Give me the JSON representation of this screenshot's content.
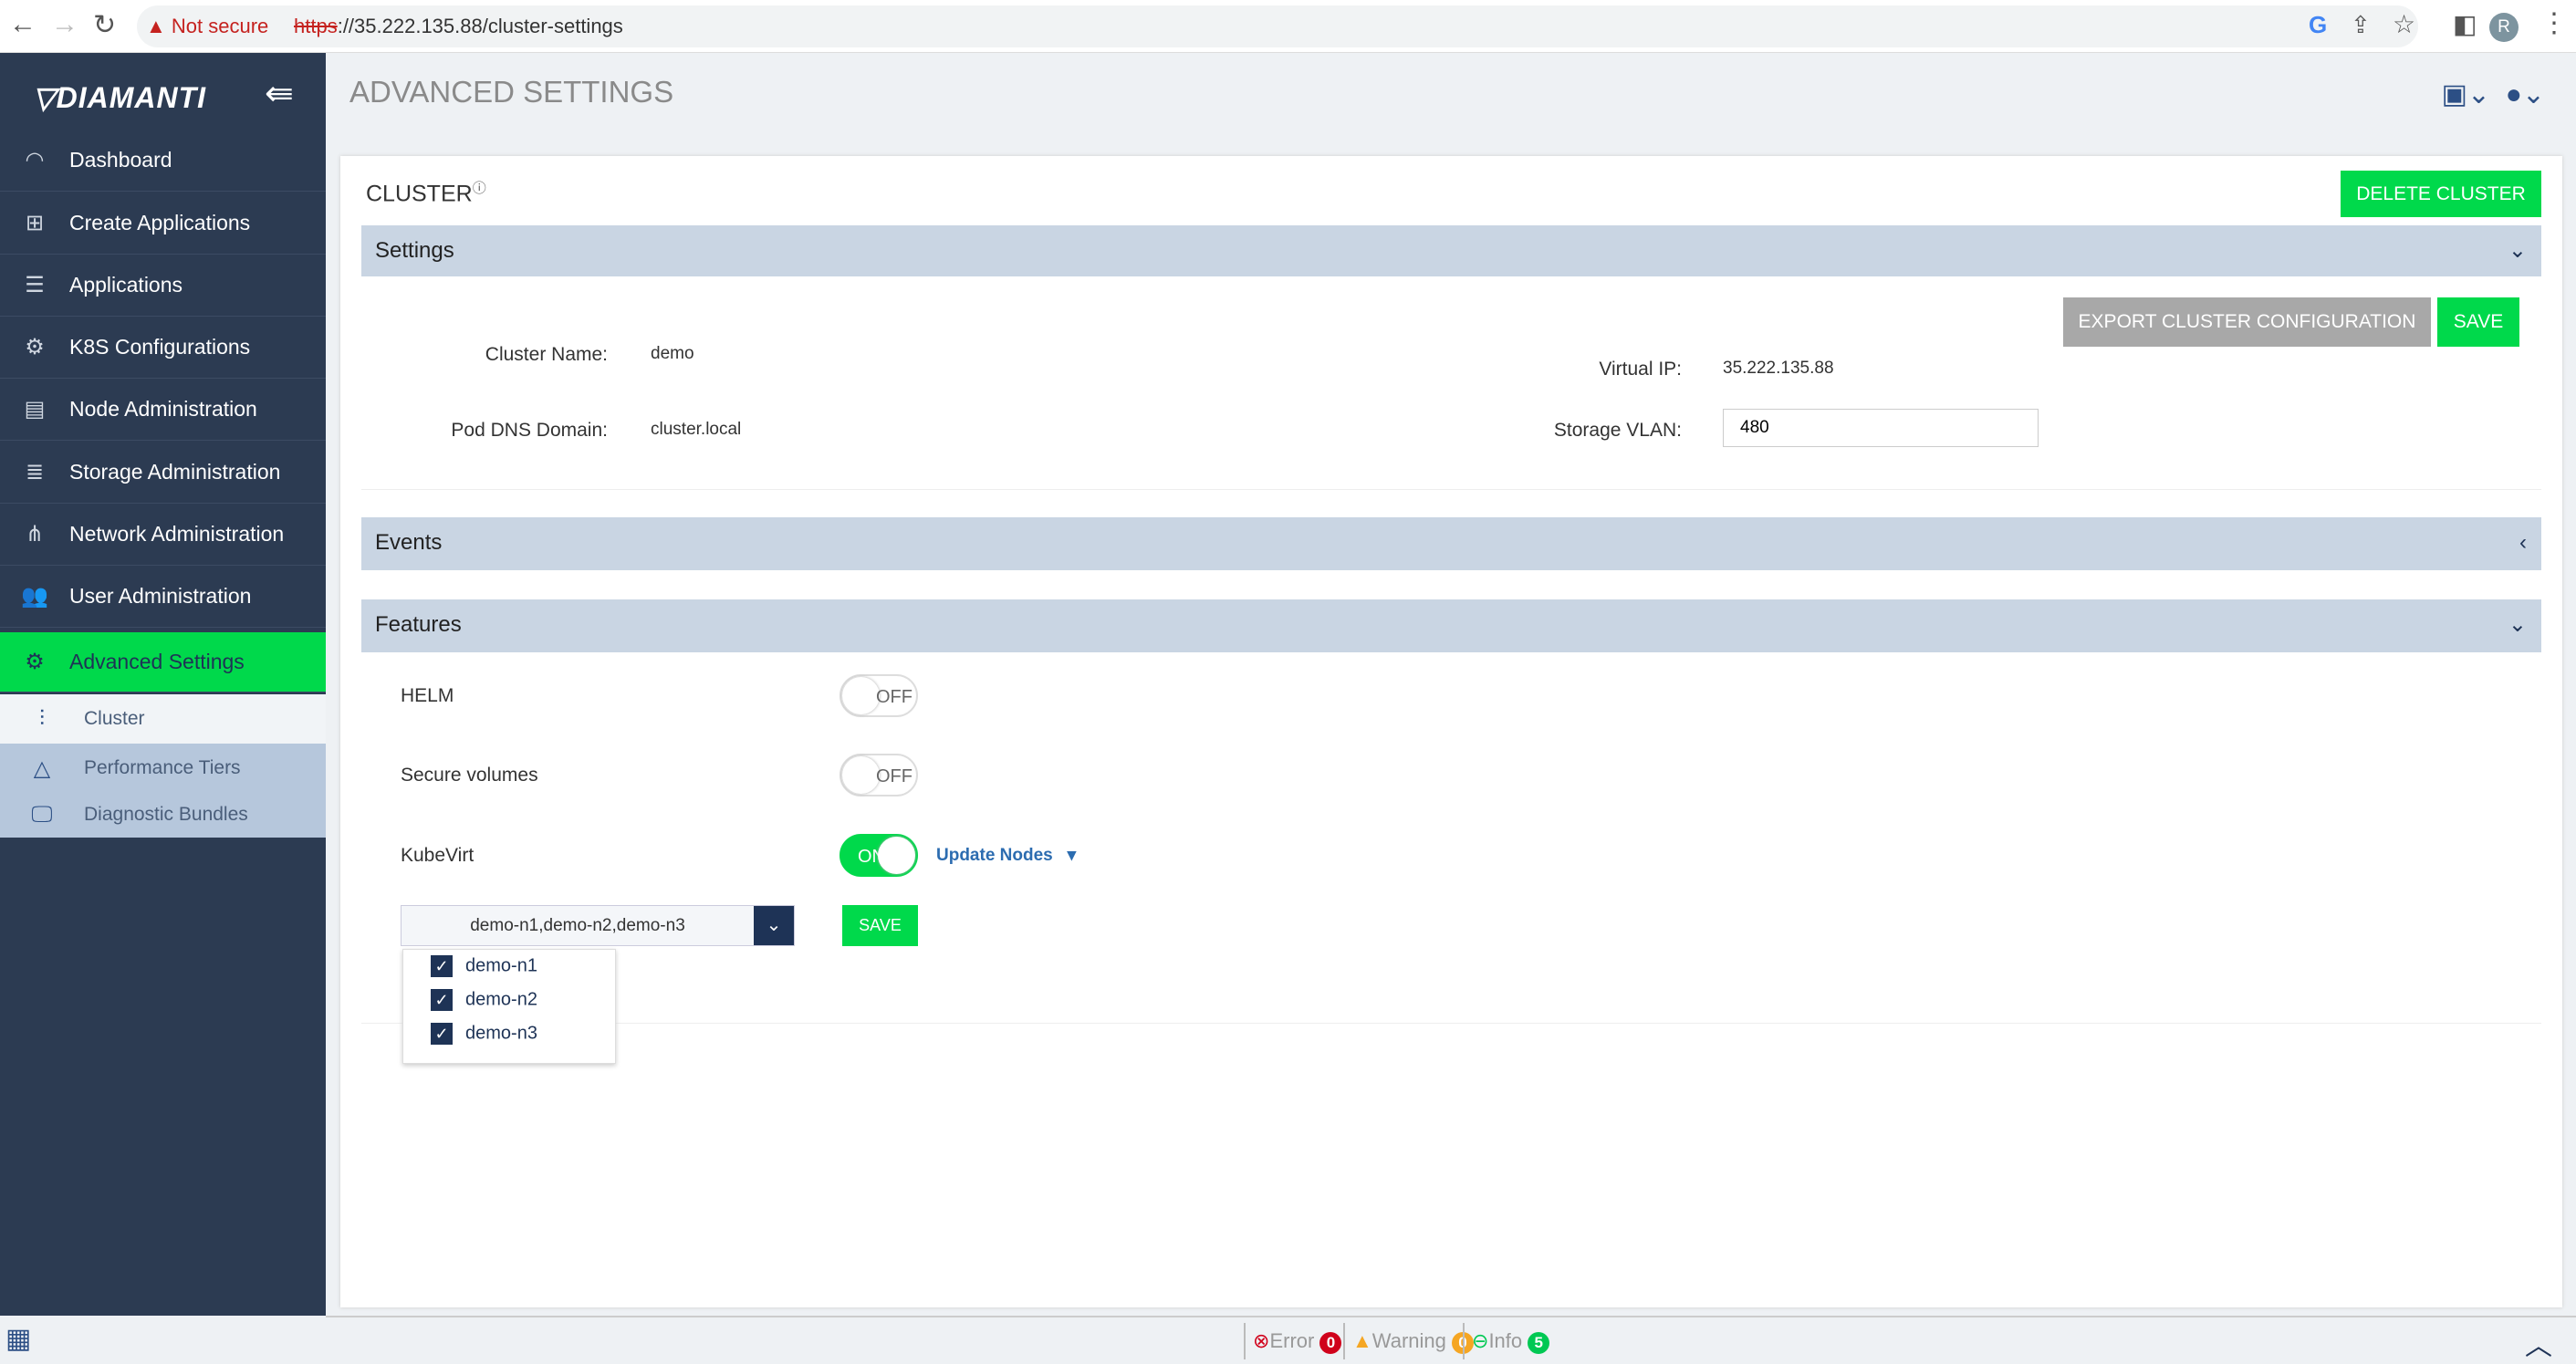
{
  "browser": {
    "not_secure": "Not secure",
    "url_scheme": "https",
    "url_rest": "://35.222.135.88/cluster-settings",
    "profile_initial": "R"
  },
  "sidebar": {
    "logo": "DIAMANTI",
    "items": [
      {
        "label": "Dashboard",
        "icon": "gauge-icon"
      },
      {
        "label": "Create Applications",
        "icon": "plus-square-icon"
      },
      {
        "label": "Applications",
        "icon": "list-icon"
      },
      {
        "label": "K8S Configurations",
        "icon": "gear-icon"
      },
      {
        "label": "Node Administration",
        "icon": "server-icon"
      },
      {
        "label": "Storage Administration",
        "icon": "database-icon"
      },
      {
        "label": "Network Administration",
        "icon": "network-icon"
      },
      {
        "label": "User Administration",
        "icon": "users-icon"
      },
      {
        "label": "Advanced Settings",
        "icon": "gears-icon"
      }
    ],
    "subitems": [
      {
        "label": "Cluster",
        "icon": "sliders-icon"
      },
      {
        "label": "Performance Tiers",
        "icon": "pyramid-icon"
      },
      {
        "label": "Diagnostic Bundles",
        "icon": "monitor-icon"
      }
    ]
  },
  "header": {
    "title": "ADVANCED SETTINGS"
  },
  "card": {
    "title": "CLUSTER",
    "delete_label": "DELETE CLUSTER",
    "settings": {
      "title": "Settings",
      "export_label": "EXPORT CLUSTER CONFIGURATION",
      "save_label": "SAVE",
      "cluster_name_label": "Cluster Name:",
      "cluster_name": "demo",
      "pod_dns_label": "Pod DNS Domain:",
      "pod_dns": "cluster.local",
      "virtual_ip_label": "Virtual IP:",
      "virtual_ip": "35.222.135.88",
      "vlan_label": "Storage VLAN:",
      "vlan": "480"
    },
    "events": {
      "title": "Events"
    },
    "features": {
      "title": "Features",
      "helm": {
        "label": "HELM",
        "state": "OFF"
      },
      "secure": {
        "label": "Secure volumes",
        "state": "OFF"
      },
      "kubevirt": {
        "label": "KubeVirt",
        "state": "ON",
        "update_nodes": "Update Nodes"
      },
      "nodes_select": "demo-n1,demo-n2,demo-n3",
      "save_label": "SAVE",
      "nodes": [
        "demo-n1",
        "demo-n2",
        "demo-n3"
      ]
    }
  },
  "footer": {
    "error_label": "Error",
    "error_count": "0",
    "warning_label": "Warning",
    "warning_count": "0",
    "info_label": "Info",
    "info_count": "5"
  },
  "colors": {
    "sidebar": "#2c3b52",
    "accent_green": "#00d94b",
    "navy": "#1e3356",
    "section_bar": "#c9d5e3"
  }
}
